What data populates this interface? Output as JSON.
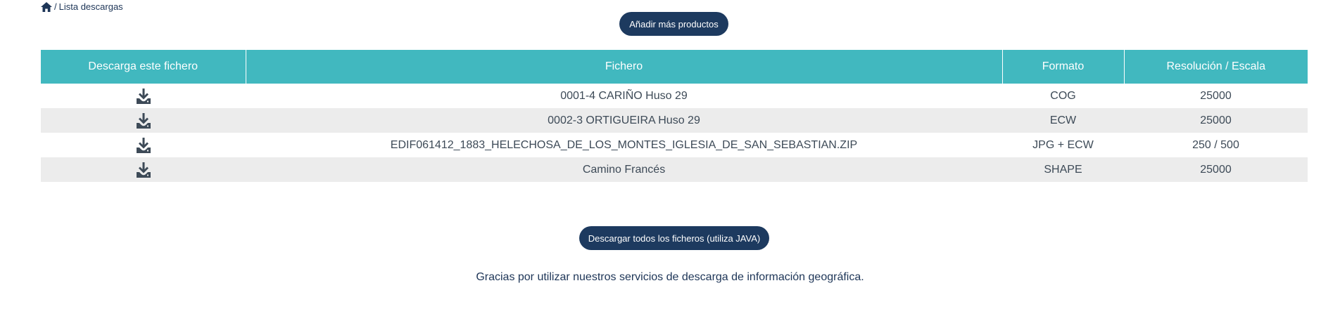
{
  "breadcrumb": {
    "home_icon": "home-icon",
    "separator": "/",
    "current": "Lista descargas"
  },
  "actions": {
    "add_products_label": "Añadir más productos",
    "download_all_label": "Descargar todos los ficheros (utiliza JAVA)"
  },
  "table": {
    "headers": [
      "Descarga este fichero",
      "Fichero",
      "Formato",
      "Resolución / Escala"
    ],
    "rows": [
      {
        "file": "0001-4 CARIÑO Huso 29",
        "format": "COG",
        "resolution": "25000"
      },
      {
        "file": "0002-3 ORTIGUEIRA Huso 29",
        "format": "ECW",
        "resolution": "25000"
      },
      {
        "file": "EDIF061412_1883_HELECHOSA_DE_LOS_MONTES_IGLESIA_DE_SAN_SEBASTIAN.ZIP",
        "format": "JPG + ECW",
        "resolution": "250 / 500"
      },
      {
        "file": "Camino Francés",
        "format": "SHAPE",
        "resolution": "25000"
      }
    ],
    "download_icon": "download-icon"
  },
  "footer": {
    "thanks": "Gracias por utilizar nuestros servicios de descarga de información geográfica."
  },
  "colors": {
    "header_bg": "#41b8bf",
    "button_bg": "#1d3a5f",
    "alt_row_bg": "#ececec",
    "text": "#3d4a57"
  }
}
